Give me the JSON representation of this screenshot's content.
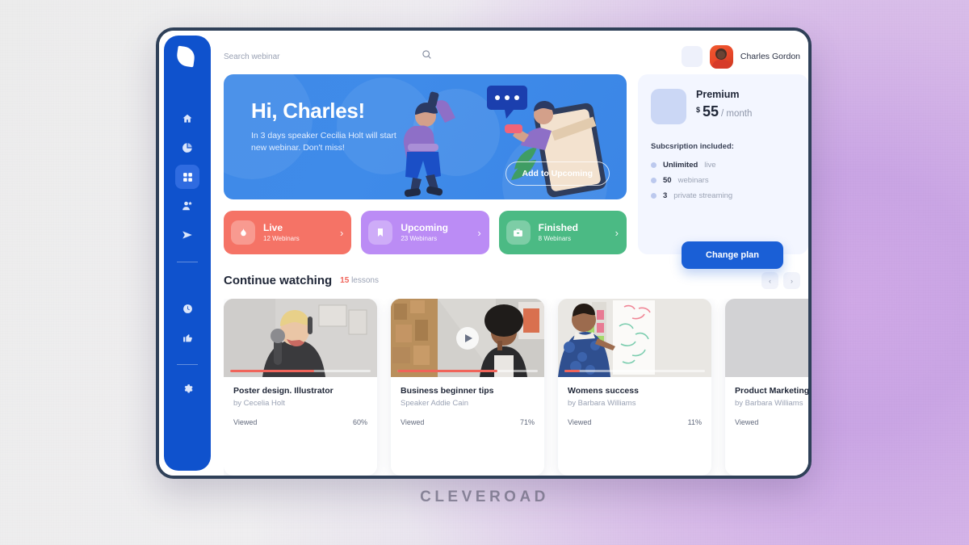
{
  "watermark": "CLEVEROAD",
  "sidebar": {
    "logo_name": "leaf-logo",
    "items": [
      {
        "name": "home",
        "icon": "home-icon",
        "active": false
      },
      {
        "name": "analytics",
        "icon": "pie-chart-icon",
        "active": false
      },
      {
        "name": "dashboard",
        "icon": "grid-icon",
        "active": true
      },
      {
        "name": "contacts",
        "icon": "user-add-icon",
        "active": false
      },
      {
        "name": "broadcast",
        "icon": "send-icon",
        "active": false
      },
      {
        "name": "history",
        "icon": "clock-icon",
        "active": false
      },
      {
        "name": "favorites",
        "icon": "thumbs-up-icon",
        "active": false
      },
      {
        "name": "settings",
        "icon": "gear-icon",
        "active": false
      }
    ]
  },
  "topbar": {
    "search_placeholder": "Search webinar",
    "search_value": "",
    "search_icon": "search-icon",
    "user_name": "Charles Gordon"
  },
  "hero": {
    "greeting": "Hi, Charles!",
    "message": "In 3 days speaker Cecilia Holt will start new webinar. Don't miss!",
    "button": "Add to Upcoming"
  },
  "status_cards": [
    {
      "title": "Live",
      "subtitle": "12 Webinars",
      "color": "#f57366",
      "icon": "flame-icon",
      "chevron": "›"
    },
    {
      "title": "Upcoming",
      "subtitle": "23 Webinars",
      "color": "#bb8cf5",
      "icon": "bookmark-icon",
      "chevron": "›"
    },
    {
      "title": "Finished",
      "subtitle": "8 Webinars",
      "color": "#4bba84",
      "icon": "briefcase-icon",
      "chevron": "›"
    }
  ],
  "premium": {
    "plan_name": "Premium",
    "currency": "$",
    "amount": "55",
    "period": "/ month",
    "included_label": "Subcsription included:",
    "features": [
      {
        "value": "Unlimited",
        "unit": "live"
      },
      {
        "value": "50",
        "unit": "webinars"
      },
      {
        "value": "3",
        "unit": "private streaming"
      }
    ],
    "change_plan": "Change plan"
  },
  "continue_watching": {
    "title": "Continue watching",
    "count": "15",
    "count_unit": "lessons",
    "prev_icon": "chevron-left-icon",
    "next_icon": "chevron-right-icon",
    "cards": [
      {
        "title": "Poster design. Illustrator",
        "author": "by Cecelia Holt",
        "meta_label": "Viewed",
        "percent": "60%",
        "progress": 60,
        "has_play": false
      },
      {
        "title": "Business beginner tips",
        "author": "Speaker Addie Cain",
        "meta_label": "Viewed",
        "percent": "71%",
        "progress": 71,
        "has_play": true
      },
      {
        "title": "Womens success",
        "author": "by Barbara Williams",
        "meta_label": "Viewed",
        "percent": "11%",
        "progress": 11,
        "has_play": false
      },
      {
        "title": "Product Marketing",
        "author": "by Barbara Williams",
        "meta_label": "Viewed",
        "percent": "",
        "progress": 0,
        "has_play": false
      }
    ]
  }
}
